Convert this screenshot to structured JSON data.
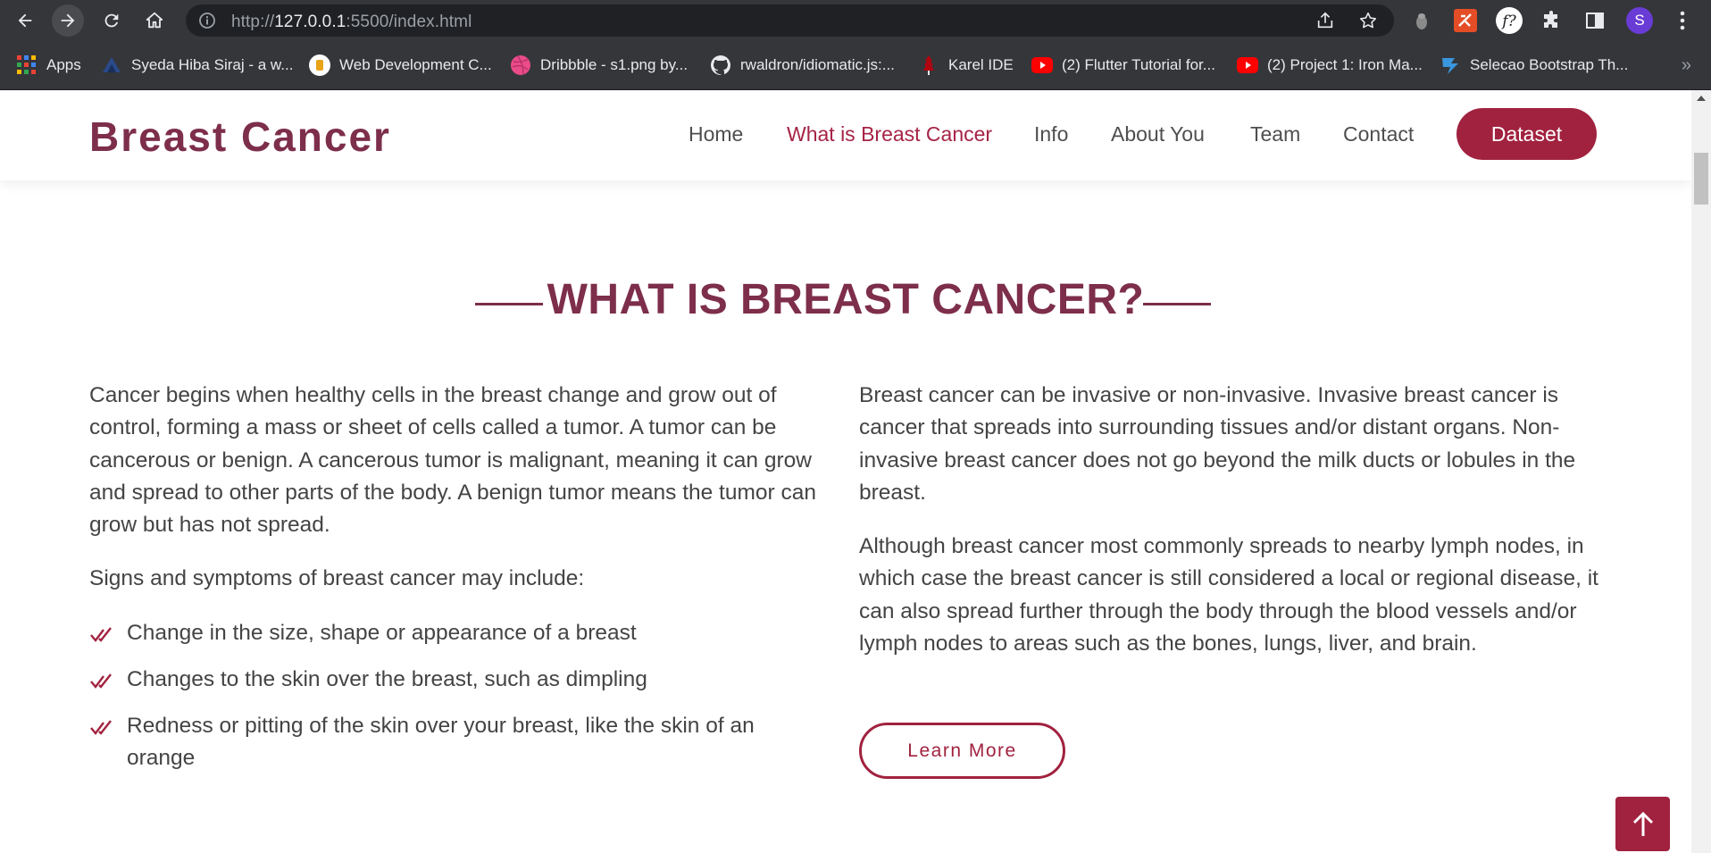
{
  "browser": {
    "url_scheme": "http://",
    "url_host": "127.0.0.1",
    "url_rest": ":5500/index.html",
    "avatar_letter": "S",
    "bookmarks": [
      {
        "label": "Apps",
        "icon": "apps-grid-icon"
      },
      {
        "label": "Syeda Hiba Siraj - a w...",
        "icon": "site-icon"
      },
      {
        "label": "Web Development C...",
        "icon": "site-icon"
      },
      {
        "label": "Dribbble - s1.png by...",
        "icon": "dribbble-icon"
      },
      {
        "label": "rwaldron/idiomatic.js:...",
        "icon": "github-icon"
      },
      {
        "label": "Karel IDE",
        "icon": "stanford-icon"
      },
      {
        "label": "(2) Flutter Tutorial for...",
        "icon": "youtube-icon"
      },
      {
        "label": "(2) Project 1: Iron Ma...",
        "icon": "youtube-icon"
      },
      {
        "label": "Selecao Bootstrap Th...",
        "icon": "bootstrap-icon"
      }
    ],
    "overflow": "»"
  },
  "site": {
    "logo": "Breast Cancer",
    "nav": [
      {
        "label": "Home",
        "active": false
      },
      {
        "label": "What is Breast Cancer",
        "active": true
      },
      {
        "label": "Info",
        "active": false
      },
      {
        "label": "About You",
        "active": false
      },
      {
        "label": "Team",
        "active": false
      },
      {
        "label": "Contact",
        "active": false
      }
    ],
    "cta": "Dataset"
  },
  "section": {
    "title": "WHAT IS BREAST CANCER?",
    "left_paragraph": "Cancer begins when healthy cells in the breast change and grow out of control, forming a mass or sheet of cells called a tumor. A tumor can be cancerous or benign. A cancerous tumor is malignant, meaning it can grow and spread to other parts of the body. A benign tumor means the tumor can grow but has not spread.",
    "signs_intro": "Signs and symptoms of breast cancer may include:",
    "signs": [
      "Change in the size, shape or appearance of a breast",
      "Changes to the skin over the breast, such as dimpling",
      "Redness or pitting of the skin over your breast, like the skin of an orange"
    ],
    "right_paragraph_1": "Breast cancer can be invasive or non-invasive. Invasive breast cancer is cancer that spreads into surrounding tissues and/or distant organs. Non-invasive breast cancer does not go beyond the milk ducts or lobules in the breast.",
    "right_paragraph_2": "Although breast cancer most commonly spreads to nearby lymph nodes, in which case the breast cancer is still considered a local or regional disease, it can also spread further through the body through the blood vessels and/or lymph nodes to areas such as the bones, lungs, liver, and brain.",
    "learn_more": "Learn More"
  },
  "colors": {
    "brand": "#7d2e4b",
    "accent": "#a1223f",
    "nav_active": "#a62446",
    "chrome": "#35363a"
  }
}
